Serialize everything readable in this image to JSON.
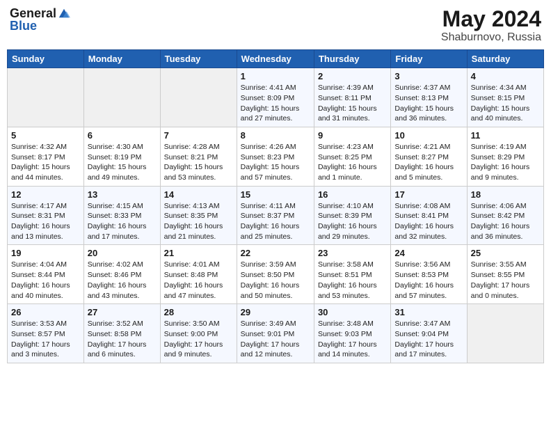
{
  "header": {
    "logo_general": "General",
    "logo_blue": "Blue",
    "month": "May 2024",
    "location": "Shaburnovo, Russia"
  },
  "days_of_week": [
    "Sunday",
    "Monday",
    "Tuesday",
    "Wednesday",
    "Thursday",
    "Friday",
    "Saturday"
  ],
  "weeks": [
    [
      {
        "day": "",
        "info": ""
      },
      {
        "day": "",
        "info": ""
      },
      {
        "day": "",
        "info": ""
      },
      {
        "day": "1",
        "info": "Sunrise: 4:41 AM\nSunset: 8:09 PM\nDaylight: 15 hours\nand 27 minutes."
      },
      {
        "day": "2",
        "info": "Sunrise: 4:39 AM\nSunset: 8:11 PM\nDaylight: 15 hours\nand 31 minutes."
      },
      {
        "day": "3",
        "info": "Sunrise: 4:37 AM\nSunset: 8:13 PM\nDaylight: 15 hours\nand 36 minutes."
      },
      {
        "day": "4",
        "info": "Sunrise: 4:34 AM\nSunset: 8:15 PM\nDaylight: 15 hours\nand 40 minutes."
      }
    ],
    [
      {
        "day": "5",
        "info": "Sunrise: 4:32 AM\nSunset: 8:17 PM\nDaylight: 15 hours\nand 44 minutes."
      },
      {
        "day": "6",
        "info": "Sunrise: 4:30 AM\nSunset: 8:19 PM\nDaylight: 15 hours\nand 49 minutes."
      },
      {
        "day": "7",
        "info": "Sunrise: 4:28 AM\nSunset: 8:21 PM\nDaylight: 15 hours\nand 53 minutes."
      },
      {
        "day": "8",
        "info": "Sunrise: 4:26 AM\nSunset: 8:23 PM\nDaylight: 15 hours\nand 57 minutes."
      },
      {
        "day": "9",
        "info": "Sunrise: 4:23 AM\nSunset: 8:25 PM\nDaylight: 16 hours\nand 1 minute."
      },
      {
        "day": "10",
        "info": "Sunrise: 4:21 AM\nSunset: 8:27 PM\nDaylight: 16 hours\nand 5 minutes."
      },
      {
        "day": "11",
        "info": "Sunrise: 4:19 AM\nSunset: 8:29 PM\nDaylight: 16 hours\nand 9 minutes."
      }
    ],
    [
      {
        "day": "12",
        "info": "Sunrise: 4:17 AM\nSunset: 8:31 PM\nDaylight: 16 hours\nand 13 minutes."
      },
      {
        "day": "13",
        "info": "Sunrise: 4:15 AM\nSunset: 8:33 PM\nDaylight: 16 hours\nand 17 minutes."
      },
      {
        "day": "14",
        "info": "Sunrise: 4:13 AM\nSunset: 8:35 PM\nDaylight: 16 hours\nand 21 minutes."
      },
      {
        "day": "15",
        "info": "Sunrise: 4:11 AM\nSunset: 8:37 PM\nDaylight: 16 hours\nand 25 minutes."
      },
      {
        "day": "16",
        "info": "Sunrise: 4:10 AM\nSunset: 8:39 PM\nDaylight: 16 hours\nand 29 minutes."
      },
      {
        "day": "17",
        "info": "Sunrise: 4:08 AM\nSunset: 8:41 PM\nDaylight: 16 hours\nand 32 minutes."
      },
      {
        "day": "18",
        "info": "Sunrise: 4:06 AM\nSunset: 8:42 PM\nDaylight: 16 hours\nand 36 minutes."
      }
    ],
    [
      {
        "day": "19",
        "info": "Sunrise: 4:04 AM\nSunset: 8:44 PM\nDaylight: 16 hours\nand 40 minutes."
      },
      {
        "day": "20",
        "info": "Sunrise: 4:02 AM\nSunset: 8:46 PM\nDaylight: 16 hours\nand 43 minutes."
      },
      {
        "day": "21",
        "info": "Sunrise: 4:01 AM\nSunset: 8:48 PM\nDaylight: 16 hours\nand 47 minutes."
      },
      {
        "day": "22",
        "info": "Sunrise: 3:59 AM\nSunset: 8:50 PM\nDaylight: 16 hours\nand 50 minutes."
      },
      {
        "day": "23",
        "info": "Sunrise: 3:58 AM\nSunset: 8:51 PM\nDaylight: 16 hours\nand 53 minutes."
      },
      {
        "day": "24",
        "info": "Sunrise: 3:56 AM\nSunset: 8:53 PM\nDaylight: 16 hours\nand 57 minutes."
      },
      {
        "day": "25",
        "info": "Sunrise: 3:55 AM\nSunset: 8:55 PM\nDaylight: 17 hours\nand 0 minutes."
      }
    ],
    [
      {
        "day": "26",
        "info": "Sunrise: 3:53 AM\nSunset: 8:57 PM\nDaylight: 17 hours\nand 3 minutes."
      },
      {
        "day": "27",
        "info": "Sunrise: 3:52 AM\nSunset: 8:58 PM\nDaylight: 17 hours\nand 6 minutes."
      },
      {
        "day": "28",
        "info": "Sunrise: 3:50 AM\nSunset: 9:00 PM\nDaylight: 17 hours\nand 9 minutes."
      },
      {
        "day": "29",
        "info": "Sunrise: 3:49 AM\nSunset: 9:01 PM\nDaylight: 17 hours\nand 12 minutes."
      },
      {
        "day": "30",
        "info": "Sunrise: 3:48 AM\nSunset: 9:03 PM\nDaylight: 17 hours\nand 14 minutes."
      },
      {
        "day": "31",
        "info": "Sunrise: 3:47 AM\nSunset: 9:04 PM\nDaylight: 17 hours\nand 17 minutes."
      },
      {
        "day": "",
        "info": ""
      }
    ]
  ]
}
